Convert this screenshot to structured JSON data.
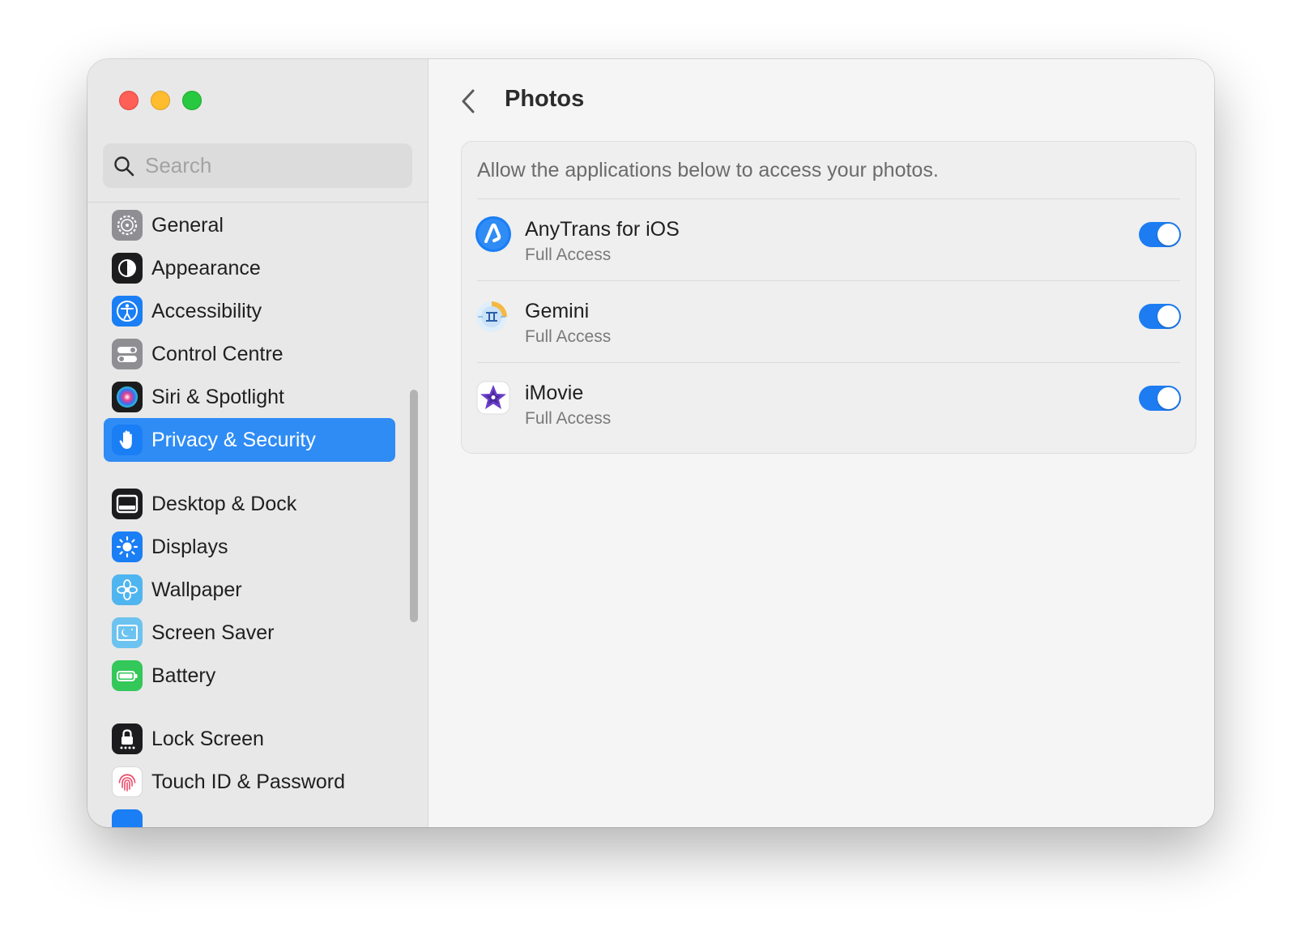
{
  "window": {
    "traffic_lights": [
      "close",
      "minimize",
      "zoom"
    ]
  },
  "sidebar": {
    "search": {
      "placeholder": "Search",
      "value": ""
    },
    "items": [
      {
        "label": "General",
        "icon": "gear-icon",
        "color": "#8e8e93"
      },
      {
        "label": "Appearance",
        "icon": "appearance-icon",
        "color": "#1c1c1e"
      },
      {
        "label": "Accessibility",
        "icon": "accessibility-icon",
        "color": "#1a7ef5"
      },
      {
        "label": "Control Centre",
        "icon": "control-centre-icon",
        "color": "#8e8e93"
      },
      {
        "label": "Siri & Spotlight",
        "icon": "siri-icon",
        "color": "#1c1c1e"
      },
      {
        "label": "Privacy & Security",
        "icon": "hand-icon",
        "color": "#1a7ef5",
        "active": true
      },
      {
        "label": "Desktop & Dock",
        "icon": "dock-icon",
        "color": "#1c1c1e"
      },
      {
        "label": "Displays",
        "icon": "sun-icon",
        "color": "#1a7ef5"
      },
      {
        "label": "Wallpaper",
        "icon": "flower-icon",
        "color": "#4fb5f0"
      },
      {
        "label": "Screen Saver",
        "icon": "screen-saver-icon",
        "color": "#6cc3f0"
      },
      {
        "label": "Battery",
        "icon": "battery-icon",
        "color": "#34c759"
      },
      {
        "label": "Lock Screen",
        "icon": "lock-icon",
        "color": "#1c1c1e"
      },
      {
        "label": "Touch ID & Password",
        "icon": "fingerprint-icon",
        "color": "#ffffff"
      }
    ]
  },
  "main": {
    "title": "Photos",
    "description": "Allow the applications below to access your photos.",
    "apps": [
      {
        "name": "AnyTrans for iOS",
        "access": "Full Access",
        "enabled": true,
        "icon": "anytrans-icon"
      },
      {
        "name": "Gemini",
        "access": "Full Access",
        "enabled": true,
        "icon": "gemini-icon"
      },
      {
        "name": "iMovie",
        "access": "Full Access",
        "enabled": true,
        "icon": "imovie-icon"
      }
    ],
    "toggle_color": "#1d7cf2"
  }
}
